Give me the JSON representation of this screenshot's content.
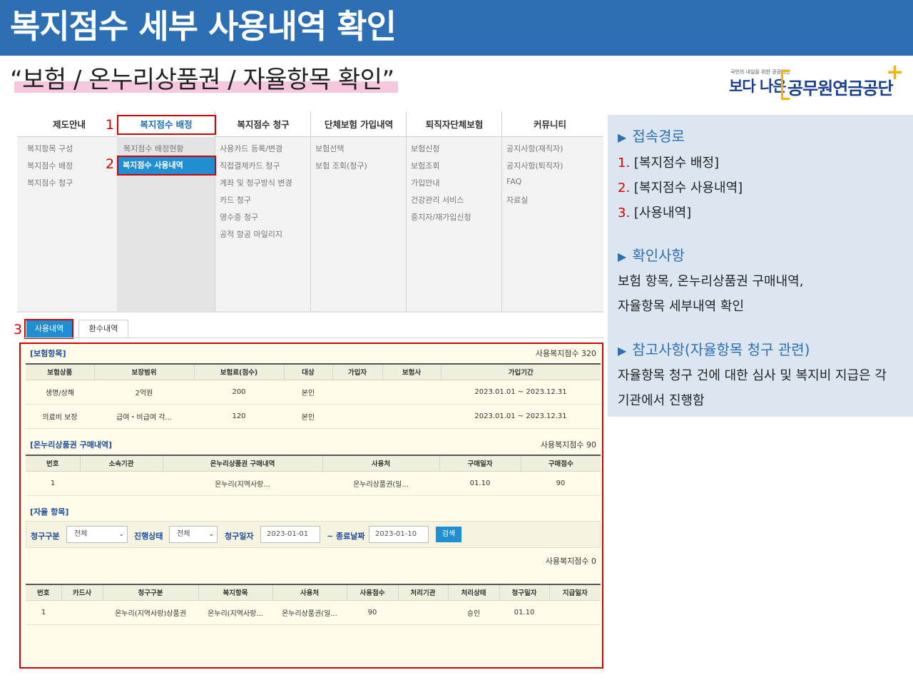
{
  "header": {
    "title": "복지점수 세부 사용내역 확인"
  },
  "subtitle": "“보험 / 온누리상품권 / 자율항목 확인”",
  "logo": {
    "small": "국민의 내일을 위한 공공혁신",
    "boda": "보다 나은",
    "name": "공무원연금공단",
    "plus": "+"
  },
  "menu": {
    "columns": [
      {
        "label": "제도안내",
        "items": [
          "복지항목 구성",
          "복지점수 배정",
          "복지점수 청구"
        ]
      },
      {
        "label": "복지점수 배정",
        "items": [
          "복지점수 배정현황",
          "복지점수 사용내역"
        ]
      },
      {
        "label": "복지점수 청구",
        "items": [
          "사용카드 등록/변경",
          "직접결제카드 청구",
          "계좌 및 청구방식 변경",
          "카드 청구",
          "영수증 청구",
          "공적 항공 마일리지"
        ]
      },
      {
        "label": "단체보험 가입내역",
        "items": [
          "보험선택",
          "보험 조회(청구)"
        ]
      },
      {
        "label": "퇴직자단체보험",
        "items": [
          "보험신청",
          "보험조회",
          "가입안내",
          "건강관리 서비스",
          "중지자/재가입신청"
        ]
      },
      {
        "label": "커뮤니티",
        "items": [
          "공지사항(재직자)",
          "공지사항(퇴직자)",
          "FAQ",
          "자료실"
        ]
      }
    ],
    "step_numbers": [
      "1",
      "2",
      "3"
    ]
  },
  "tabs": [
    {
      "label": "사용내역"
    },
    {
      "label": "환수내역"
    }
  ],
  "insurance": {
    "title": "[보험항목]",
    "points": "사용복지점수 320",
    "headers": [
      "보험상품",
      "보장범위",
      "보험료(점수)",
      "대상",
      "가입자",
      "보험사",
      "가입기간"
    ],
    "rows": [
      [
        "생명/상해",
        "2억원",
        "200",
        "본인",
        "",
        "",
        "2023.01.01 ~ 2023.12.31"
      ],
      [
        "의료비 보장",
        "급여・비급여 각...",
        "120",
        "본인",
        "",
        "",
        "2023.01.01 ~ 2023.12.31"
      ]
    ]
  },
  "voucher": {
    "title": "[온누리상품권 구매내역]",
    "points": "사용복지점수 90",
    "headers": [
      "번호",
      "소속기관",
      "온누리상품권 구매내역",
      "사용처",
      "구매일자",
      "구매점수"
    ],
    "rows": [
      [
        "1",
        "",
        "온누리(지역사랑...",
        "온누리상품권(일...",
        "01.10",
        "90"
      ]
    ]
  },
  "autonomy": {
    "title": "[자율 항목]",
    "filters": {
      "claim_type_label": "청구구분",
      "claim_type_value": "전체",
      "status_label": "진행상태",
      "status_value": "전체",
      "date_label": "청구일자",
      "date_from": "2023-01-01",
      "end_label": "~ 종료날짜",
      "date_to": "2023-01-10",
      "search_label": "검색"
    },
    "points": "사용복지점수 0",
    "headers": [
      "번호",
      "카드사",
      "청구구분",
      "복지항목",
      "사용처",
      "사용점수",
      "처리기관",
      "처리상태",
      "청구일자",
      "지급일자"
    ],
    "rows": [
      [
        "1",
        "",
        "온누리(지역사랑)상품권",
        "온누리(지역사랑...",
        "온누리상품권(일...",
        "90",
        "",
        "승인",
        "01.10",
        ""
      ]
    ]
  },
  "info": {
    "route_title": "접속경로",
    "route_steps": [
      {
        "n": "1.",
        "text": " [복지점수 배정]"
      },
      {
        "n": "2.",
        "text": " [복지점수 사용내역]"
      },
      {
        "n": "3.",
        "text": " [사용내역]"
      }
    ],
    "check_title": "확인사항",
    "check_lines": [
      "보험 항목, 온누리상품권 구매내역,",
      "자율항목 세부내역 확인"
    ],
    "note_title": "참고사항(자율항목 청구 관련)",
    "note_lines": [
      "자율항목 청구 건에 대한 심사 및 복지비 지급은 각",
      "기관에서 진행함"
    ],
    "triangle": "▶"
  },
  "colors": {
    "header_blue": "#2d6fb5",
    "accent_red": "#d40000",
    "button_blue": "#1f8fd1",
    "panel_yellow": "#fffde9",
    "info_bg": "#dce6f1"
  }
}
